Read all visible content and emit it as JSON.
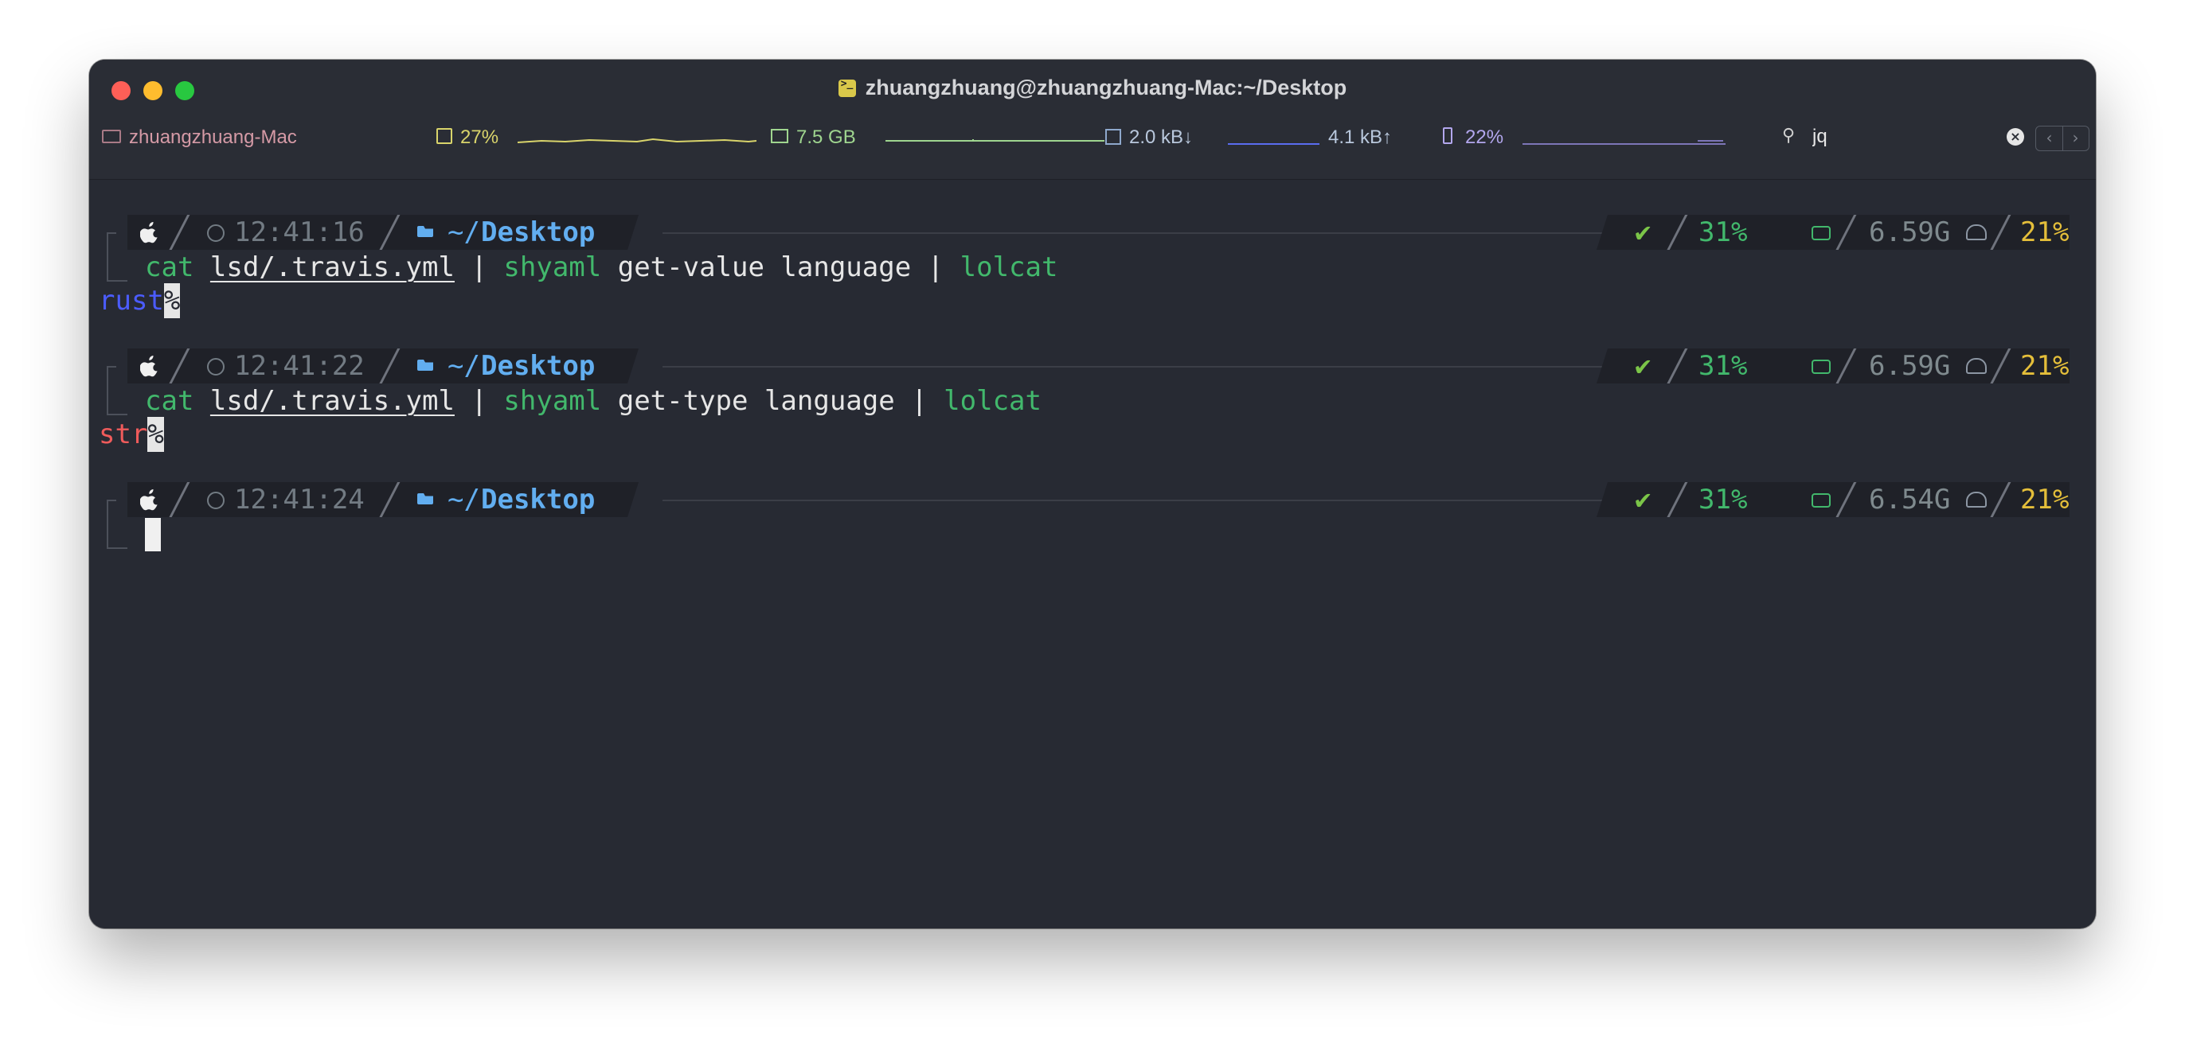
{
  "window": {
    "title": "zhuangzhuang@zhuangzhuang-Mac:~/Desktop"
  },
  "statusbar": {
    "hostname": "zhuangzhuang-Mac",
    "cpu": "27%",
    "memory": "7.5 GB",
    "net_down": "2.0 kB↓",
    "net_up": "4.1 kB↑",
    "battery": "22%",
    "search_value": "jq",
    "icons": [
      "laptop-icon",
      "cpu-icon",
      "memory-icon",
      "network-icon",
      "battery-icon",
      "search-icon",
      "clear-icon",
      "chevron-left-icon",
      "chevron-right-icon"
    ]
  },
  "colors": {
    "terminal_bg": "#272a33",
    "accent_blue": "#62aef0",
    "accent_green": "#42b86c",
    "accent_yellow": "#e4be3a",
    "rust_output": "#4b5cff",
    "str_output": "#ef5b5b"
  },
  "prompts": [
    {
      "time": "12:41:16",
      "dir_prefix": "~/",
      "dir_name": "Desktop",
      "status": "✔",
      "disk": "31%",
      "mem": "6.59G",
      "battery": "21%"
    },
    {
      "time": "12:41:22",
      "dir_prefix": "~/",
      "dir_name": "Desktop",
      "status": "✔",
      "disk": "31%",
      "mem": "6.59G",
      "battery": "21%"
    },
    {
      "time": "12:41:24",
      "dir_prefix": "~/",
      "dir_name": "Desktop",
      "status": "✔",
      "disk": "31%",
      "mem": "6.54G",
      "battery": "21%"
    }
  ],
  "commands": [
    {
      "cmd": "cat",
      "file": "lsd/.travis.yml",
      "pipe1": "|",
      "tool": "shyaml",
      "args": "get-value language",
      "pipe2": "|",
      "filter": "lolcat",
      "output": "rust",
      "eol_mark": "%"
    },
    {
      "cmd": "cat",
      "file": "lsd/.travis.yml",
      "pipe1": "|",
      "tool": "shyaml",
      "args": "get-type language",
      "pipe2": "|",
      "filter": "lolcat",
      "output": "str",
      "eol_mark": "%"
    }
  ]
}
